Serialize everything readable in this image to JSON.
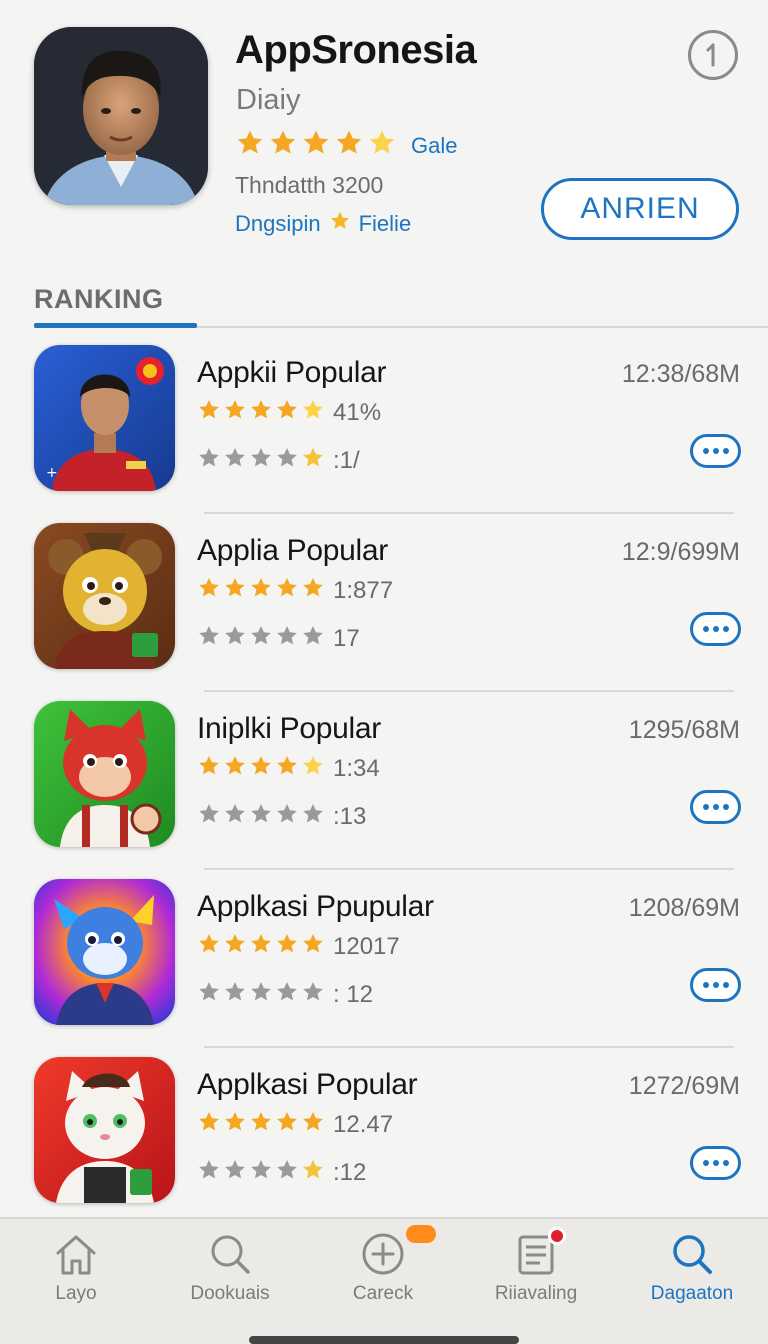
{
  "header": {
    "title": "AppSronesia",
    "subtitle": "Diaiy",
    "rating_label": "Gale",
    "rating": 4.5,
    "downloads": "Thndatth 3200",
    "developer": "Dngsipin",
    "developer_suffix": "Fielie",
    "primary_button": "ANRIEN",
    "accent": "#1d74c0",
    "star_color": "#f5a623",
    "info_icon": "info-circle-icon"
  },
  "section": {
    "label": "RANKING"
  },
  "apps": [
    {
      "name": "Appkii Popular",
      "size": "12:38/68M",
      "rating": 4.5,
      "rating_value": "41%",
      "secondary_rating": 4.5,
      "secondary_value": ":1/"
    },
    {
      "name": "Applia Popular",
      "size": "12:9/699M",
      "rating": 5,
      "rating_value": "1:877",
      "secondary_rating": 5,
      "secondary_value": "17"
    },
    {
      "name": "Iniplki Popular",
      "size": "1295/68M",
      "rating": 4.5,
      "rating_value": "1:34",
      "secondary_rating": 5,
      "secondary_value": ":13"
    },
    {
      "name": "Applkasi Ppupular",
      "size": "1208/69M",
      "rating": 5,
      "rating_value": "12017",
      "secondary_rating": 5,
      "secondary_value": ": 12"
    },
    {
      "name": "Applkasi Popular",
      "size": "1272/69M",
      "rating": 5,
      "rating_value": "12.47",
      "secondary_rating": 4.5,
      "secondary_value": ":12"
    }
  ],
  "nav": [
    {
      "label": "Layo",
      "icon": "home-icon",
      "active": false
    },
    {
      "label": "Dookuais",
      "icon": "search-icon",
      "active": false
    },
    {
      "label": "Careck",
      "icon": "plus-circle-icon",
      "active": false
    },
    {
      "label": "Riiavaling",
      "icon": "list-icon",
      "active": false
    },
    {
      "label": "Dagaaton",
      "icon": "search-icon",
      "active": true
    }
  ]
}
